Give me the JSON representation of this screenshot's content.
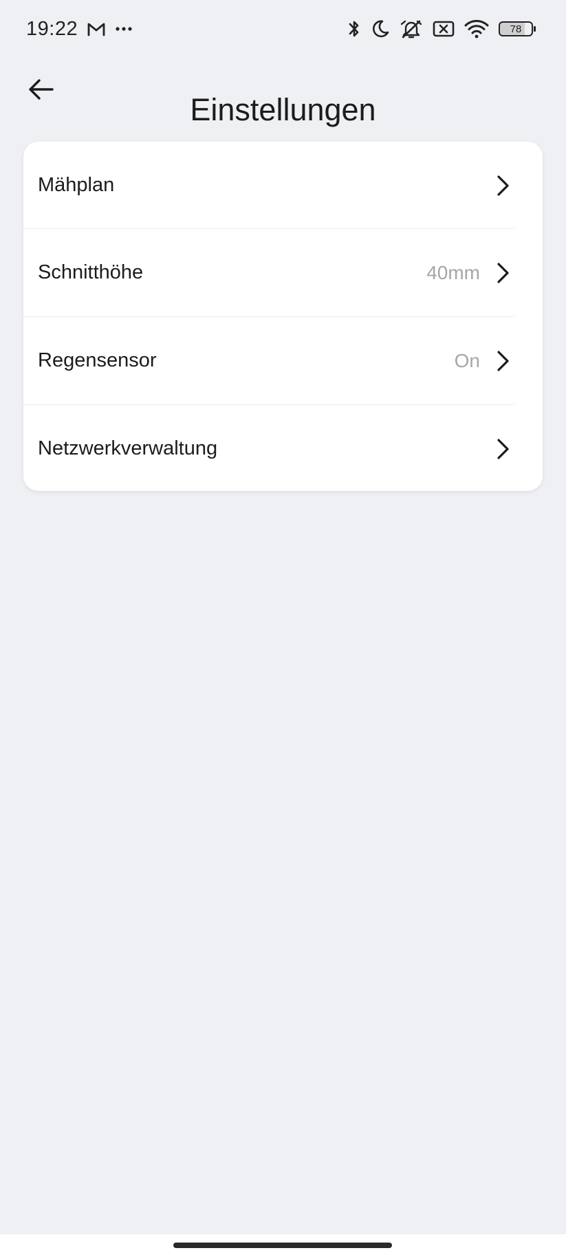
{
  "status_bar": {
    "time": "19:22",
    "battery_level": "78",
    "icons": [
      "gmail-icon",
      "more-dots-icon",
      "bluetooth-icon",
      "moon-icon",
      "alarm-off-icon",
      "no-sim-icon",
      "wifi-icon",
      "battery-icon"
    ]
  },
  "header": {
    "title": "Einstellungen",
    "back_icon": "arrow-left-icon"
  },
  "settings": {
    "items": [
      {
        "label": "Mähplan",
        "value": ""
      },
      {
        "label": "Schnitthöhe",
        "value": "40mm"
      },
      {
        "label": "Regensensor",
        "value": "On"
      },
      {
        "label": "Netzwerkverwaltung",
        "value": ""
      }
    ]
  },
  "colors": {
    "background": "#eff0f4",
    "card": "#ffffff",
    "text_primary": "#1c1c1c",
    "text_secondary": "#a6a6a6",
    "divider": "#ececec"
  }
}
